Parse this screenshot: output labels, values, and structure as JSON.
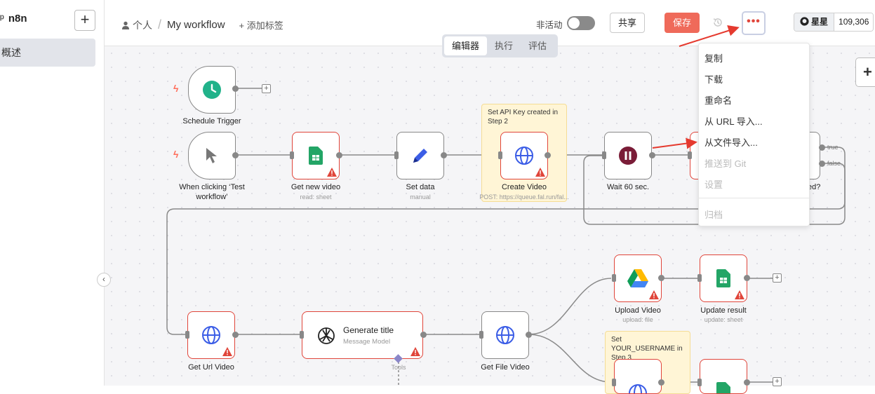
{
  "app": {
    "logo": "n8n",
    "sidebar_add": "+",
    "sidebar_overview": "概述"
  },
  "header": {
    "project": "个人",
    "workflow_name": "My workflow",
    "add_tag": "+ 添加标签",
    "inactive_label": "非活动",
    "share_label": "共享",
    "save_label": "保存",
    "more_label": "•••",
    "star_label": "星星",
    "star_count": "109,306"
  },
  "tabs": [
    {
      "label": "编辑器",
      "active": true
    },
    {
      "label": "执行",
      "active": false
    },
    {
      "label": "评估",
      "active": false
    }
  ],
  "menu": {
    "items": [
      {
        "label": "复制",
        "disabled": false
      },
      {
        "label": "下载",
        "disabled": false
      },
      {
        "label": "重命名",
        "disabled": false
      },
      {
        "label": "从 URL 导入...",
        "disabled": false
      },
      {
        "label": "从文件导入...",
        "disabled": false
      },
      {
        "label": "推送到 Git",
        "disabled": true
      },
      {
        "label": "设置",
        "disabled": true
      },
      {
        "label": "归档",
        "disabled": true
      }
    ]
  },
  "nodes": {
    "schedule": {
      "label": "Schedule Trigger"
    },
    "manual": {
      "label": "When clicking ‘Test workflow’"
    },
    "get_new_video": {
      "label": "Get new video",
      "sub": "read: sheet"
    },
    "set_data": {
      "label": "Set data",
      "sub": "manual"
    },
    "create_video": {
      "label": "Create Video",
      "sub": "POST: https://queue.fal.run/fal..."
    },
    "wait": {
      "label": "Wait 60 sec."
    },
    "completed_partial": {
      "label": "ed?"
    },
    "if_true": "true",
    "if_false": "false",
    "get_url_video": {
      "label": "Get Url Video"
    },
    "generate_title": {
      "label": "Generate title",
      "sub": "Message Model",
      "tools": "Tools"
    },
    "get_file_video": {
      "label": "Get File Video"
    },
    "upload_video": {
      "label": "Upload Video",
      "sub": "upload: file"
    },
    "update_result": {
      "label": "Update result",
      "sub": "update: sheet"
    }
  },
  "stickies": {
    "api_key": "Set API Key created in Step 2",
    "username": "Set YOUR_USERNAME in Step 3"
  },
  "colors": {
    "accent": "#ef6a5a",
    "error_border": "#e0453a",
    "annotation_arrow": "#e53a2f",
    "sticky_bg": "#fff5d6"
  }
}
